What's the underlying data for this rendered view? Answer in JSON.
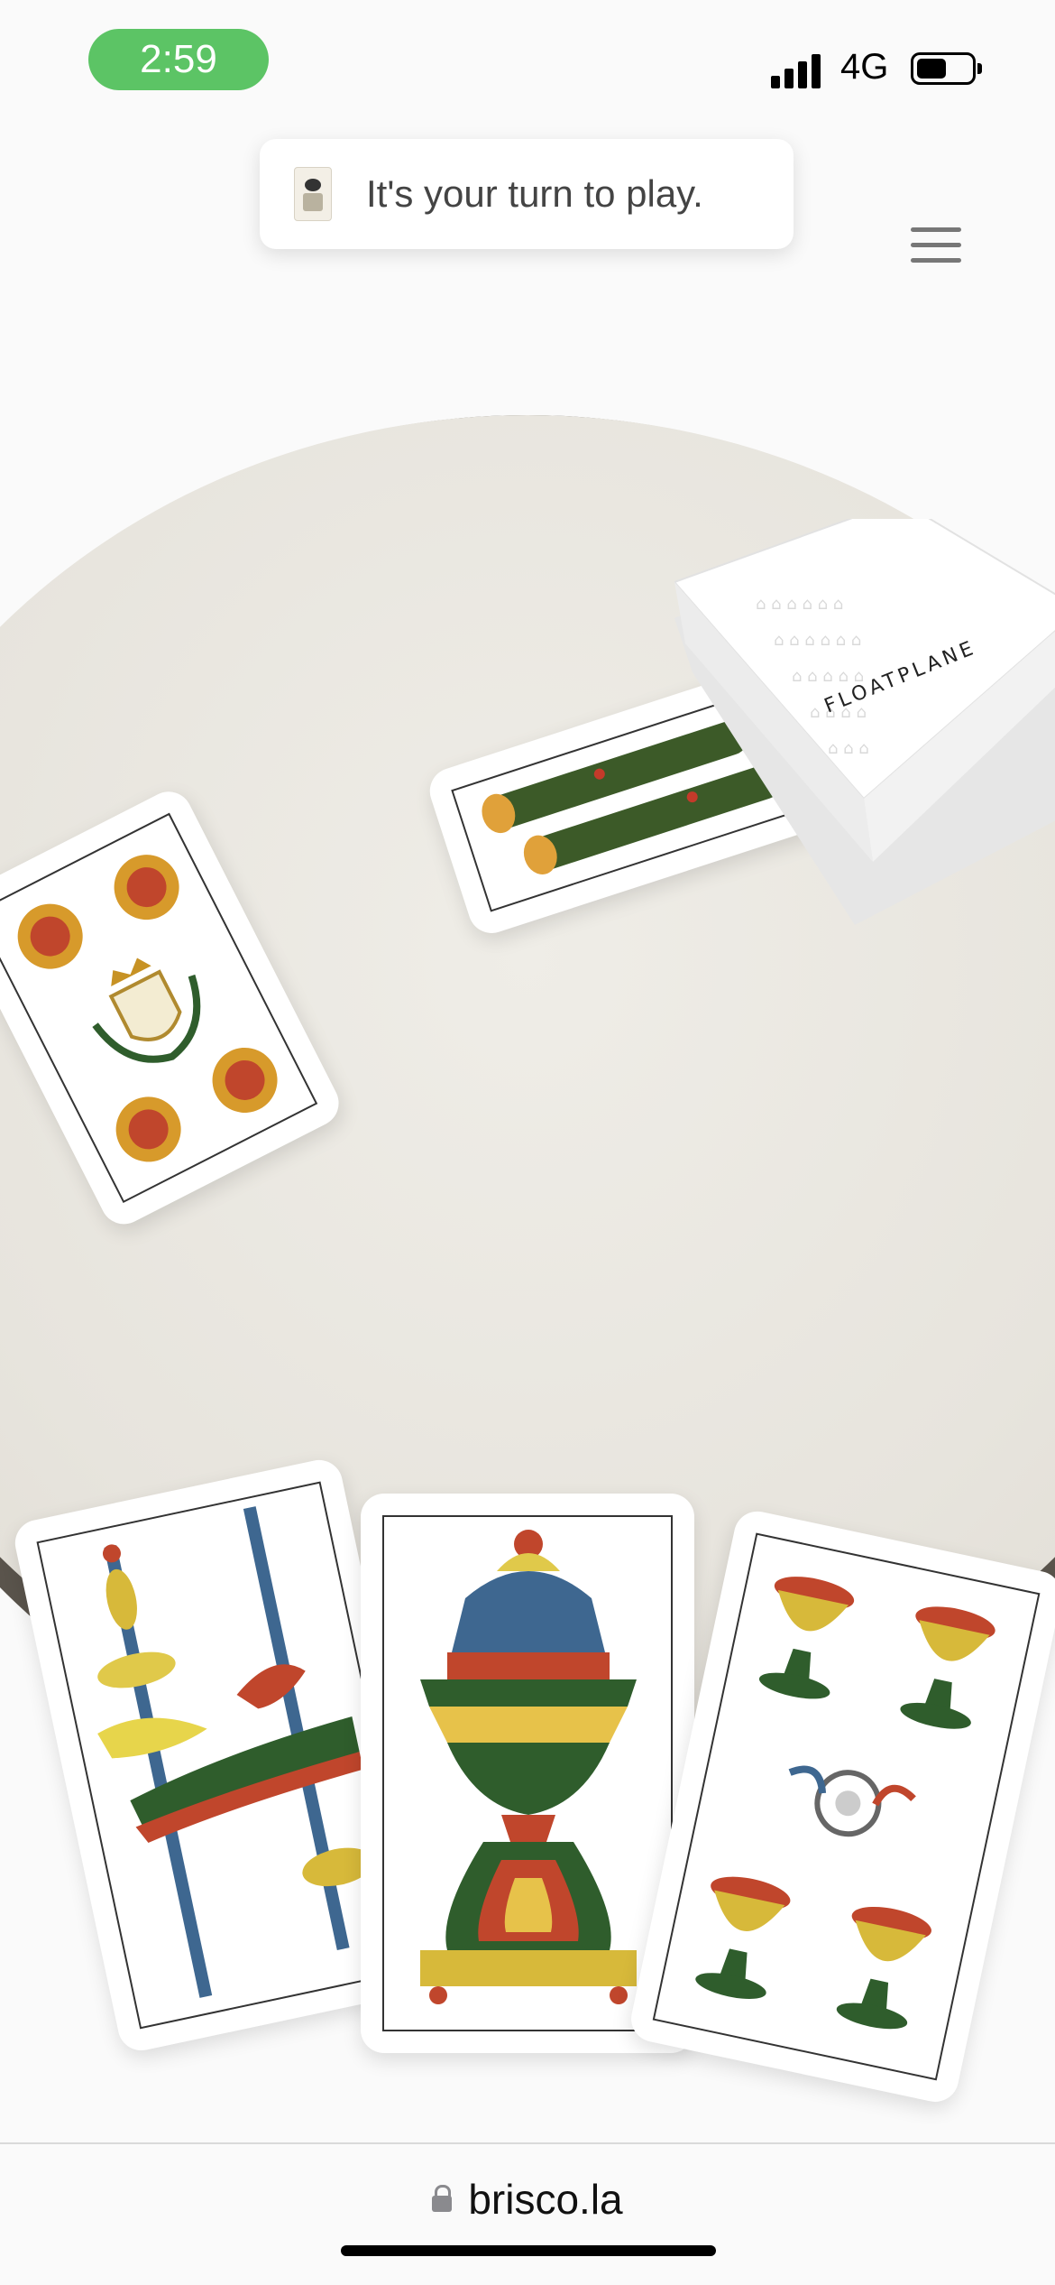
{
  "status_bar": {
    "time": "2:59",
    "network": "4G",
    "battery_level": 0.55
  },
  "toast": {
    "message": "It's your turn to play.",
    "icon": "jester-card-icon"
  },
  "menu": {
    "icon": "hamburger-menu-icon"
  },
  "deck": {
    "brand": "FLOATPLANE"
  },
  "table_cards": [
    {
      "name": "card-two-of-clubs",
      "suit": "clubs",
      "rank": "2"
    },
    {
      "name": "card-four-of-coins",
      "suit": "coins",
      "rank": "4"
    }
  ],
  "hand_cards": [
    {
      "name": "card-two-of-swords",
      "suit": "swords",
      "rank": "2"
    },
    {
      "name": "card-ace-of-cups",
      "suit": "cups",
      "rank": "A"
    },
    {
      "name": "card-five-of-cups",
      "suit": "cups",
      "rank": "5"
    }
  ],
  "browser": {
    "url": "brisco.la"
  },
  "colors": {
    "time_pill": "#5cc465",
    "table": "#e7e4dd",
    "table_edge": "#5a544c"
  }
}
